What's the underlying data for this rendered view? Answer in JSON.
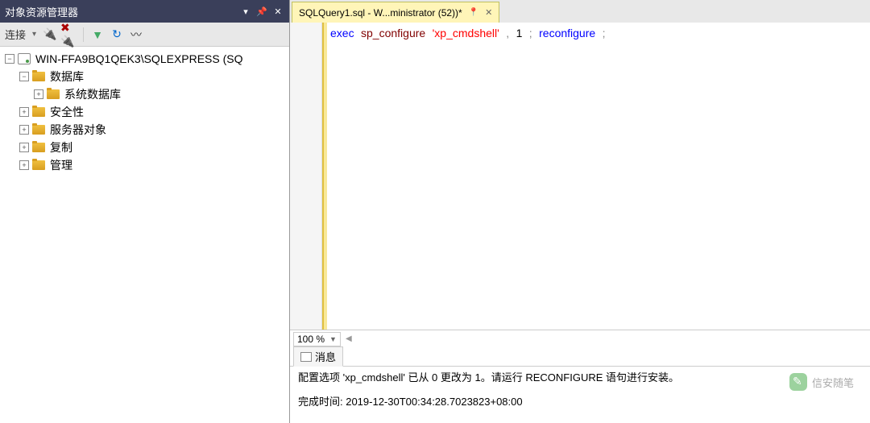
{
  "sidebar": {
    "title": "对象资源管理器",
    "toolbar_label": "连接",
    "nodes": {
      "server": "WIN-FFA9BQ1QEK3\\SQLEXPRESS (SQ",
      "databases": "数据库",
      "system_databases": "系统数据库",
      "security": "安全性",
      "server_objects": "服务器对象",
      "replication": "复制",
      "management": "管理"
    }
  },
  "tab": {
    "label": "SQLQuery1.sql - W...ministrator (52))*"
  },
  "editor": {
    "code": {
      "exec": "exec",
      "sp": "sp_configure",
      "str1": "'xp_cmdshell'",
      "comma": ",",
      "num": "1",
      "semi1": ";",
      "recon": "reconfigure",
      "semi2": ";"
    }
  },
  "zoom": {
    "value": "100 %"
  },
  "results": {
    "tab_label": "消息",
    "line1": "配置选项 'xp_cmdshell' 已从 0 更改为 1。请运行 RECONFIGURE 语句进行安装。",
    "line2": "完成时间: 2019-12-30T00:34:28.7023823+08:00"
  },
  "watermark": {
    "text": "信安随笔"
  }
}
